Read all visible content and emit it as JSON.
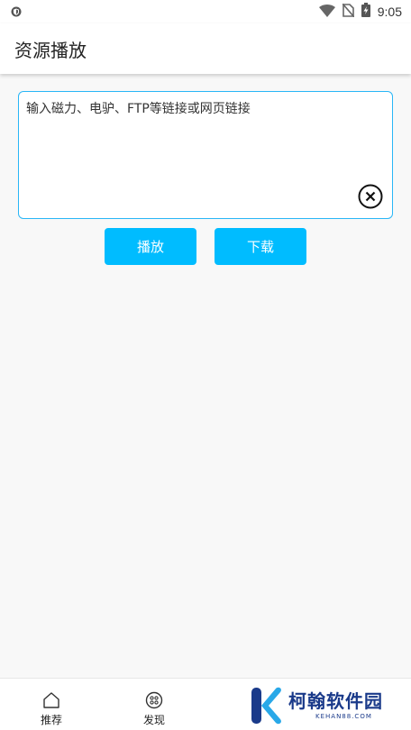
{
  "status_bar": {
    "time": "9:05"
  },
  "app_bar": {
    "title": "资源播放"
  },
  "link_input": {
    "placeholder": "输入磁力、电驴、FTP等链接或网页链接",
    "value": ""
  },
  "buttons": {
    "play_label": "播放",
    "download_label": "下载"
  },
  "bottom_nav": {
    "items": [
      {
        "label": "推荐",
        "icon": "home-icon"
      },
      {
        "label": "发现",
        "icon": "discover-icon"
      }
    ]
  },
  "watermark": {
    "name": "柯翰软件园",
    "url": "KEHAN88.COM"
  },
  "colors": {
    "accent": "#00bcff",
    "input_border": "#29b6f6",
    "background": "#f8f8f8",
    "brand": "#1a3a8a"
  }
}
